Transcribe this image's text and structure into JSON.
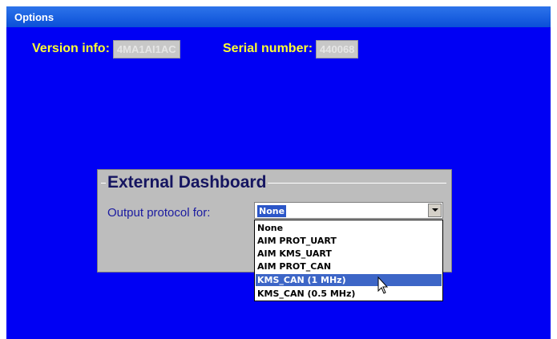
{
  "window": {
    "title": "Options"
  },
  "info": {
    "version_label": "Version info:",
    "version_value": "4MA1AI1AC",
    "serial_label": "Serial number:",
    "serial_value": "440068"
  },
  "panel": {
    "title": "External Dashboard",
    "protocol_label": "Output protocol for:"
  },
  "select": {
    "selected_value": "None",
    "options": [
      "None",
      "AIM PROT_UART",
      "AIM KMS_UART",
      "AIM PROT_CAN",
      "KMS_CAN (1 MHz)",
      "KMS_CAN (0.5 MHz)"
    ],
    "highlighted_index": 4
  },
  "colors": {
    "background": "#0000f4",
    "label_yellow": "#ffff33",
    "panel_gray": "#bdbdbd",
    "highlight": "#3d66c7"
  },
  "icons": {
    "dropdown_arrow": "chevron-down-icon",
    "pointer": "mouse-cursor-icon"
  }
}
